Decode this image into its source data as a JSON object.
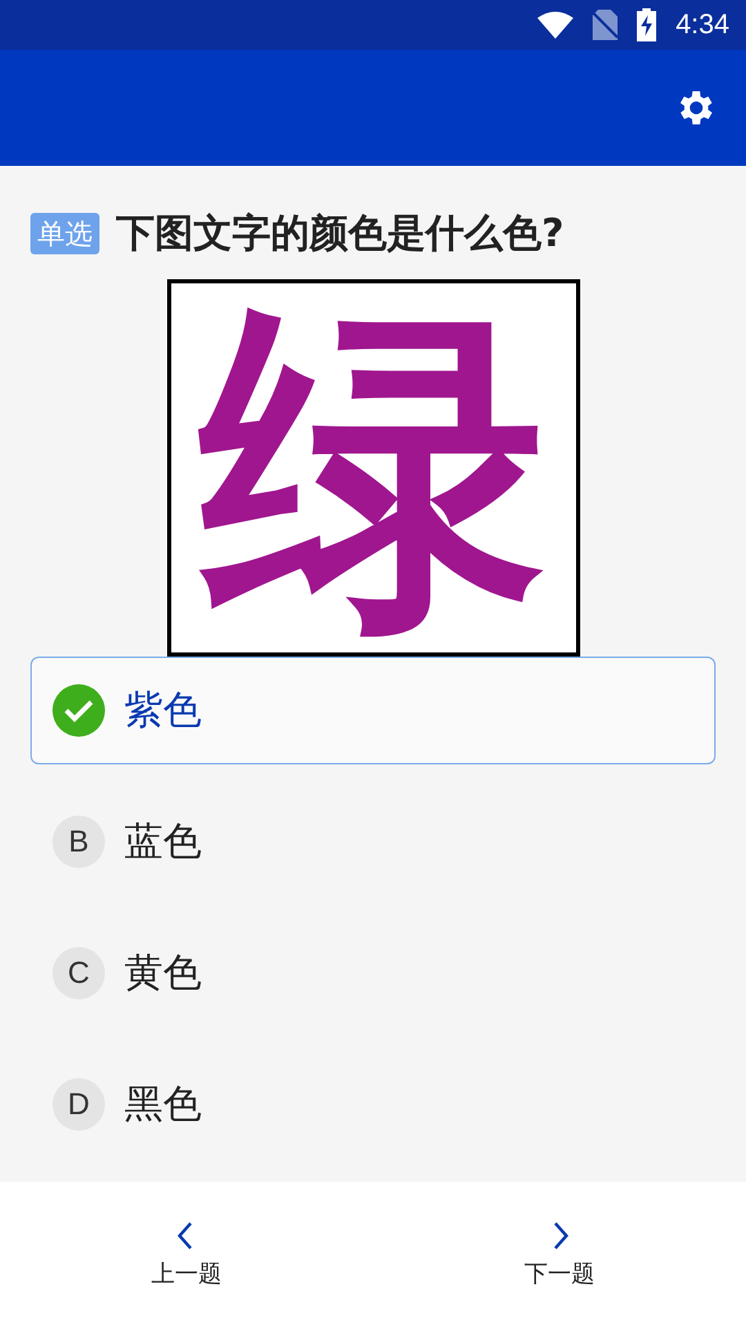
{
  "status_bar": {
    "time": "4:34"
  },
  "question": {
    "type_badge": "单选",
    "text": "下图文字的颜色是什么色?",
    "image": {
      "text": "绿",
      "color": "#a0168f"
    }
  },
  "options": [
    {
      "text": "紫色",
      "selected": true
    },
    {
      "letter": "B",
      "text": "蓝色",
      "selected": false
    },
    {
      "letter": "C",
      "text": "黄色",
      "selected": false
    },
    {
      "letter": "D",
      "text": "黑色",
      "selected": false
    }
  ],
  "bottom_nav": [
    {
      "kind": "prev",
      "label": "上一题"
    },
    {
      "kind": "next",
      "label": "下一题"
    }
  ]
}
